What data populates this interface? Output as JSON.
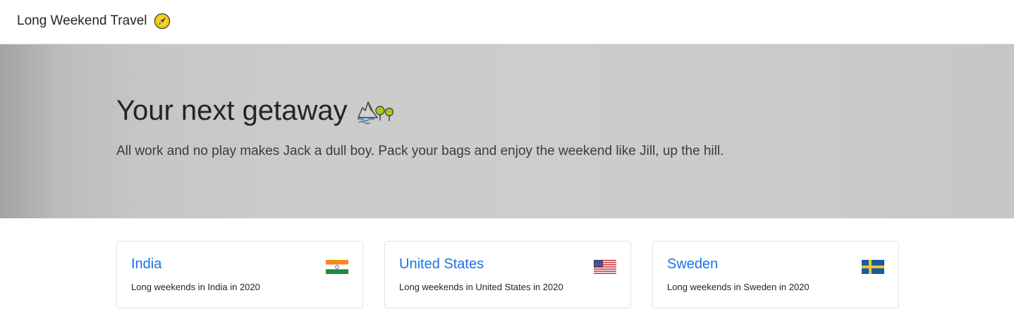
{
  "navbar": {
    "brand_text": "Long Weekend Travel",
    "brand_icon": "compass-icon"
  },
  "hero": {
    "title": "Your next getaway",
    "title_icon": "mountain-landscape-icon",
    "lead": "All work and no play makes Jack a dull boy. Pack your bags and enjoy the weekend like Jill, up the hill."
  },
  "countries": [
    {
      "name": "India",
      "description": "Long weekends in India in 2020",
      "flag_icon": "india-flag-icon"
    },
    {
      "name": "United States",
      "description": "Long weekends in United States in 2020",
      "flag_icon": "us-flag-icon"
    },
    {
      "name": "Sweden",
      "description": "Long weekends in Sweden in 2020",
      "flag_icon": "sweden-flag-icon"
    }
  ],
  "colors": {
    "link": "#1a73e8",
    "text": "#212529",
    "hero_background": "#cbcbc9",
    "card_border": "#dfe2e5"
  }
}
